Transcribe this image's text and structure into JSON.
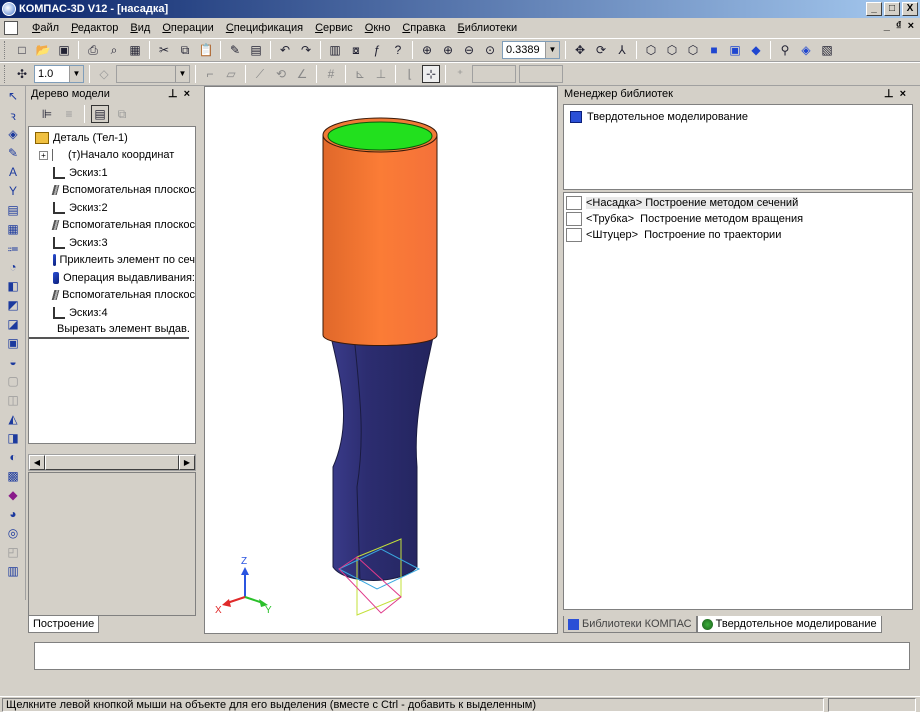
{
  "window": {
    "title": "КОМПАС-3D V12 - [насадка]",
    "minimize": "_",
    "maximize": "□",
    "close": "X",
    "mdi_minimize": "_",
    "mdi_restore": "₫",
    "mdi_close": "×"
  },
  "menu": {
    "items": [
      "Файл",
      "Редактор",
      "Вид",
      "Операции",
      "Спецификация",
      "Сервис",
      "Окно",
      "Справка",
      "Библиотеки"
    ]
  },
  "toolbar1": {
    "zoom_value": "0.3389"
  },
  "toolbar2": {
    "step_value": "1.0"
  },
  "tree_panel": {
    "title": "Дерево модели",
    "pin": "⊥",
    "close": "×",
    "items": [
      {
        "label": "Деталь (Тел-1)",
        "icon": "part-icon"
      },
      {
        "label": "(т)Начало координат",
        "icon": "origin-icon"
      },
      {
        "label": "Эскиз:1",
        "icon": "sketch-icon"
      },
      {
        "label": "Вспомогательная плоскос",
        "icon": "plane-icon"
      },
      {
        "label": "Эскиз:2",
        "icon": "sketch-icon"
      },
      {
        "label": "Вспомогательная плоскос",
        "icon": "plane-icon"
      },
      {
        "label": "Эскиз:3",
        "icon": "sketch-icon"
      },
      {
        "label": "Приклеить элемент по сеч",
        "icon": "loft-icon"
      },
      {
        "label": "Операция выдавливания:",
        "icon": "extrude-icon"
      },
      {
        "label": "Вспомогательная плоскос",
        "icon": "plane-icon"
      },
      {
        "label": "Эскиз:4",
        "icon": "sketch-icon"
      },
      {
        "label": "Вырезать элемент выдав.",
        "icon": "cut-extrude-icon"
      }
    ],
    "tab_label": "Построение"
  },
  "viewport": {
    "axis_x": "X",
    "axis_y": "Y",
    "axis_z": "Z",
    "colors": {
      "top_face": "#22e01e",
      "upper_body": "#fb7c36",
      "lower_body": "#2c2d70"
    }
  },
  "library_panel": {
    "title": "Менеджер библиотек",
    "pin": "⊥",
    "close": "×",
    "root_item": "Твердотельное моделирование",
    "rows": [
      {
        "tag": "<Насадка>",
        "desc": "Построение методом сечений"
      },
      {
        "tag": "<Трубка>",
        "desc": "Построение методом вращения"
      },
      {
        "tag": "<Штуцер>",
        "desc": "Построение по траектории"
      }
    ],
    "tabs": [
      "Библиотеки КОМПАС",
      "Твердотельное моделирование"
    ]
  },
  "status": {
    "hint": "Щелкните левой кнопкой мыши на объекте для его выделения (вместе с Ctrl - добавить к выделенным)"
  }
}
